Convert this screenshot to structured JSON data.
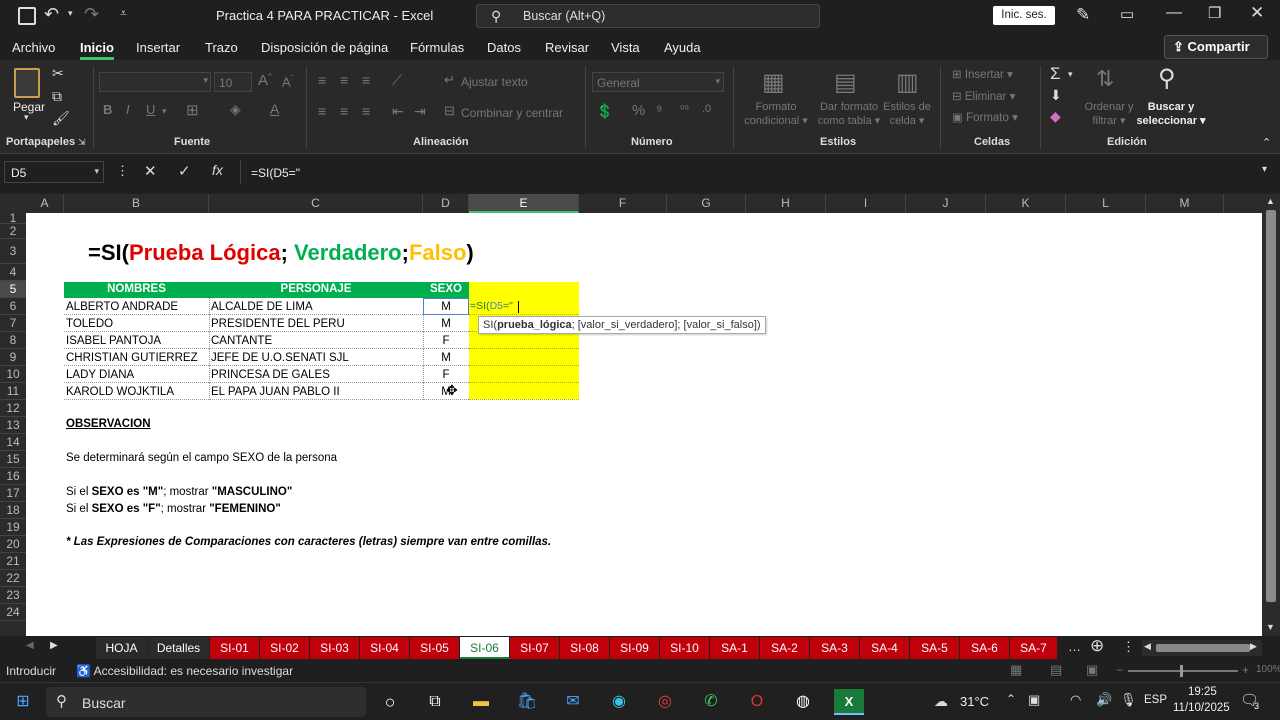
{
  "title": {
    "filename": "Practica 4 PARA PRACTICAR",
    "app": "Excel",
    "search": "Buscar (Alt+Q)",
    "signin": "Inic. ses."
  },
  "menu": [
    "Archivo",
    "Inicio",
    "Insertar",
    "Trazo",
    "Disposición de página",
    "Fórmulas",
    "Datos",
    "Revisar",
    "Vista",
    "Ayuda"
  ],
  "share": "Compartir",
  "ribbon": {
    "paste": "Pegar",
    "groups": [
      "Portapapeles",
      "Fuente",
      "Alineación",
      "Número",
      "Estilos",
      "Celdas",
      "Edición"
    ],
    "font_size": "10",
    "wrap": "Ajustar texto",
    "merge": "Combinar y centrar",
    "number_format": "General",
    "cond_format": [
      "Formato",
      "condicional"
    ],
    "table_format": [
      "Dar formato",
      "como tabla"
    ],
    "cell_styles": [
      "Estilos de",
      "celda"
    ],
    "insert": "Insertar",
    "delete": "Eliminar",
    "format": "Formato",
    "sort": [
      "Ordenar y",
      "filtrar"
    ],
    "find": [
      "Buscar y",
      "seleccionar"
    ]
  },
  "formula_bar": {
    "name_box": "D5",
    "content": "=SI(D5=\""
  },
  "columns": [
    "A",
    "B",
    "C",
    "D",
    "E",
    "F",
    "G",
    "H",
    "I",
    "J",
    "K",
    "L",
    "M"
  ],
  "rows": [
    "1",
    "2",
    "3",
    "4",
    "5",
    "6",
    "7",
    "8",
    "9",
    "10",
    "11",
    "12",
    "13",
    "14",
    "15",
    "16",
    "17",
    "18",
    "19",
    "20",
    "21",
    "22",
    "23",
    "24"
  ],
  "sheet": {
    "formula_title": {
      "prefix": "=SI(",
      "prueba": "Prueba Lógica",
      "sep1": "; ",
      "verdadero": "Verdadero",
      "sep2": ";",
      "falso": "Falso",
      "suffix": ")"
    },
    "headers": [
      "NOMBRES",
      "PERSONAJE",
      "SEXO"
    ],
    "data": [
      [
        "ALBERTO ANDRADE",
        "ALCALDE DE LIMA",
        "M"
      ],
      [
        "TOLEDO",
        "PRESIDENTE DEL PERU",
        "M"
      ],
      [
        "ISABEL PANTOJA",
        "CANTANTE",
        "F"
      ],
      [
        "CHRISTIAN GUTIERREZ",
        "JEFE DE U.O.SENATI SJL",
        "M"
      ],
      [
        "LADY DIANA",
        "PRINCESA DE GALES",
        "F"
      ],
      [
        "KAROLD WOJKTILA",
        "EL PAPA JUAN PABLO II",
        "M"
      ]
    ],
    "editing_cell": {
      "prefix": "=SI(",
      "ref": "D5",
      "suffix": "=\""
    },
    "tooltip": {
      "fn": "SI(",
      "arg1": "prueba_lógica",
      "rest": "; [valor_si_verdadero]; [valor_si_falso])"
    },
    "observacion": "OBSERVACION",
    "line1": "Se determinará según el campo SEXO de la persona",
    "line2": {
      "a": "Si el ",
      "b": "SEXO es \"M\"",
      "c": "; mostrar ",
      "d": "\"MASCULINO\""
    },
    "line3": {
      "a": "Si el ",
      "b": "SEXO es \"F\"",
      "c": "; mostrar ",
      "d": "\"FEMENINO\""
    },
    "note": "* Las Expresiones de Comparaciones con caracteres (letras) siempre van entre comillas."
  },
  "tabs": [
    "HOJA",
    "Detalles",
    "SI-01",
    "SI-02",
    "SI-03",
    "SI-04",
    "SI-05",
    "SI-06",
    "SI-07",
    "SI-08",
    "SI-09",
    "SI-10",
    "SA-1",
    "SA-2",
    "SA-3",
    "SA-4",
    "SA-5",
    "SA-6",
    "SA-7"
  ],
  "status": {
    "mode": "Introducir",
    "accessibility": "Accesibilidad: es necesario investigar",
    "zoom": "100%"
  },
  "taskbar": {
    "search": "Buscar",
    "temp": "31°C",
    "lang": "ESP",
    "time": "19:25",
    "date": "11/10/2025",
    "notif": "3"
  },
  "colors": {
    "green": "#00b050",
    "yellow": "#ffff00",
    "red": "#e00000",
    "gold": "#ffc000",
    "excel_green": "#1a7a3a"
  }
}
